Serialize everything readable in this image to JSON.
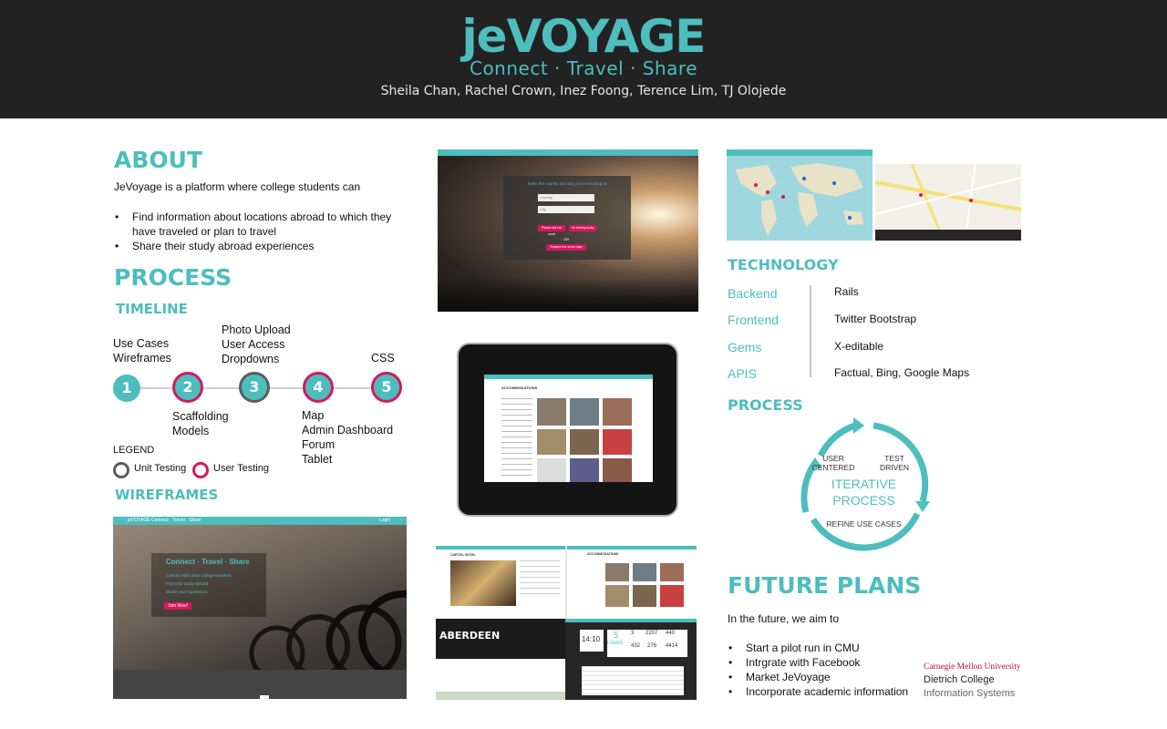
{
  "header": {
    "logo": "jeVOYAGE",
    "tagline": "Connect · Travel · Share",
    "authors": "Sheila Chan, Rachel Crown, Inez Foong, Terence Lim, TJ Olojede"
  },
  "about": {
    "heading": "ABOUT",
    "intro": "JeVoyage is a platform where college students can",
    "bullets": [
      "Find information about locations abroad to which they have traveled or plan to travel",
      "Share their study abroad experiences"
    ]
  },
  "process": {
    "heading": "PROCESS",
    "timeline_heading": "TIMELINE",
    "steps": [
      {
        "num": "1",
        "above": [
          "Use Cases",
          "Wireframes"
        ],
        "below": [],
        "type": "unit"
      },
      {
        "num": "2",
        "above": [],
        "below": [
          "Scaffolding",
          "Models"
        ],
        "type": "user"
      },
      {
        "num": "3",
        "above": [
          "Photo Upload",
          "User Access",
          "Dropdowns"
        ],
        "below": [],
        "type": "unit"
      },
      {
        "num": "4",
        "above": [],
        "below": [
          "Map",
          "Admin Dashboard",
          "Forum",
          "Tablet"
        ],
        "type": "user"
      },
      {
        "num": "5",
        "above": [
          "CSS"
        ],
        "below": [],
        "type": "user"
      }
    ],
    "legend_title": "LEGEND",
    "legend_unit": "Unit Testing",
    "legend_user": "User Testing",
    "wireframes_heading": "WIREFRAMES"
  },
  "screens": {
    "hero_prompt": "Enter the country and city you're heading to",
    "hero_country": "Country",
    "hero_city": "City",
    "hero_btn1": "Please tell me more",
    "hero_btn2": "I'm feeling lucky",
    "hero_or": "OR",
    "hero_btn3": "Explore the world map",
    "tablet_title": "ACCOMMODATIONS",
    "wf_nav": "jeVOYAGE  Connect · Travel · Share",
    "wf_login": "Login",
    "wf_title": "Connect · Travel · Share",
    "wf_items": [
      "Connect with other college travelers",
      "Find your study abroad",
      "Share your experience"
    ],
    "wf_join": "Join Now!",
    "collage_city": "ABERDEEN",
    "collage_hotel": "CAPITAL HOTEL",
    "collage_accom": "ACCOMMODATIONS",
    "dash_time": "14:10",
    "dash_users_num": "5",
    "dash_users_label": "USERS",
    "dash_stats": [
      "3",
      "2207",
      "440",
      "432",
      "276",
      "4414"
    ]
  },
  "technology": {
    "heading": "TECHNOLOGY",
    "rows": [
      {
        "key": "Backend",
        "value": "Rails"
      },
      {
        "key": "Frontend",
        "value": "Twitter Bootstrap"
      },
      {
        "key": "Gems",
        "value": "X-editable"
      },
      {
        "key": "APIS",
        "value": "Factual, Bing, Google Maps"
      }
    ]
  },
  "process_cycle": {
    "heading": "PROCESS",
    "left": "USER CENTERED",
    "right": "TEST DRIVEN",
    "center_line1": "ITERATIVE",
    "center_line2": "PROCESS",
    "bottom": "REFINE USE CASES"
  },
  "future": {
    "heading": "FUTURE PLANS",
    "intro": "In the future, we aim to",
    "bullets": [
      "Start a pilot run in CMU",
      "Intrgrate with Facebook",
      "Market JeVoyage",
      "Incorporate academic information"
    ]
  },
  "cmu": {
    "line1": "Carnegie Mellon University",
    "line2": "Dietrich College",
    "line3": "Information Systems"
  },
  "colors": {
    "teal": "#4dbdbd",
    "pink": "#d6185f",
    "dark": "#222222",
    "gray": "#5c5c5c"
  }
}
